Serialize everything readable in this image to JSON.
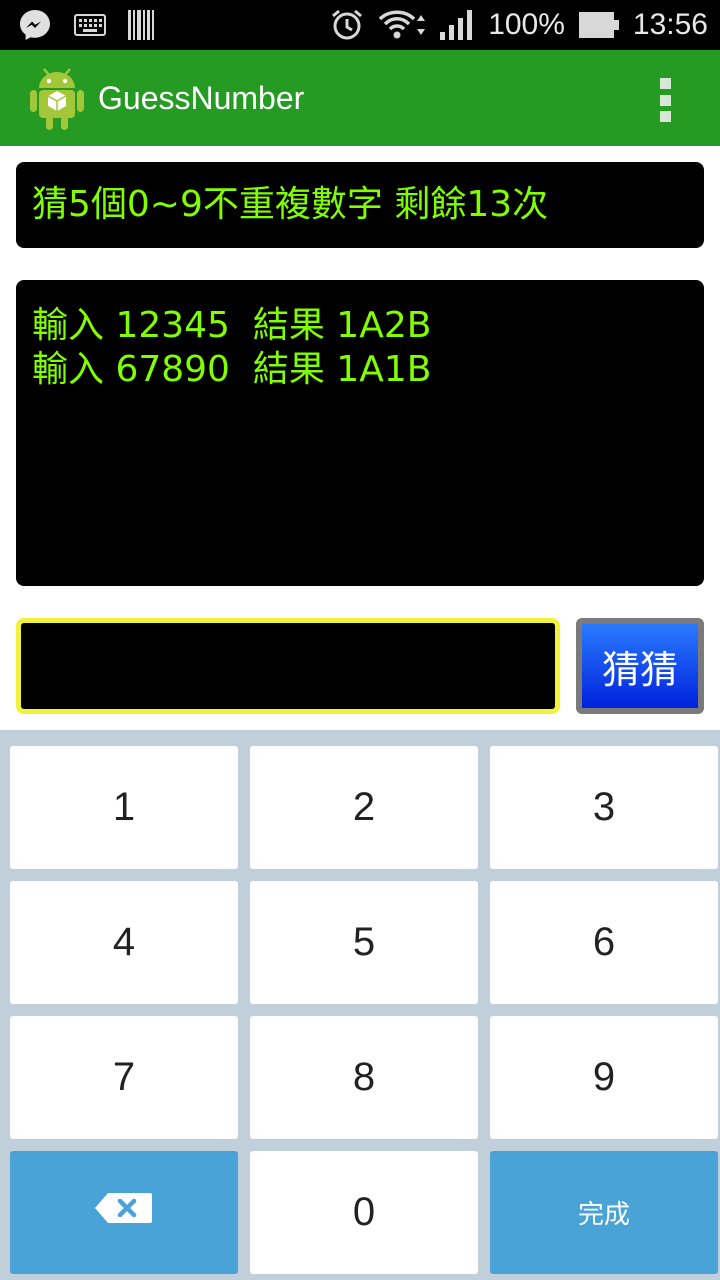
{
  "status_bar": {
    "battery_text": "100%",
    "time": "13:56",
    "icons": [
      "messenger-icon",
      "keyboard-icon",
      "barcode-icon",
      "alarm-icon",
      "wifi-icon",
      "signal-icon",
      "battery-icon"
    ]
  },
  "action_bar": {
    "title": "GuessNumber",
    "background": "#259b24",
    "icons": [
      "android-app-icon",
      "overflow-menu-icon"
    ]
  },
  "game": {
    "status_text": "猜5個0~9不重複數字 剩餘13次",
    "history": [
      "輸入 12345  結果 1A2B",
      "輸入 67890  結果 1A1B"
    ],
    "input_value": "",
    "guess_button_label": "猜猜",
    "text_color": "#7fff00"
  },
  "keyboard": {
    "keys": [
      "1",
      "2",
      "3",
      "4",
      "5",
      "6",
      "7",
      "8",
      "9",
      "0"
    ],
    "backspace_icon": "backspace-icon",
    "done_label": "完成",
    "accent": "#4aa3d6"
  }
}
